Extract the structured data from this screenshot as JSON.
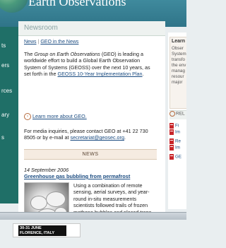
{
  "banner": {
    "title": "Earth Observations"
  },
  "leftnav": {
    "items": [
      "ts",
      "ers",
      "rces",
      "ary",
      "s"
    ]
  },
  "newsroom": {
    "title": "Newsroom",
    "tabs": [
      "News",
      "GEO in the News"
    ],
    "intro": {
      "p1": "The ",
      "em": "Group on Earth Observations",
      "p2": " (GEO) is leading a worldwide effort to build a Global Earth Observation System of Systems (GEOSS) over the next 10 years, as set forth in the ",
      "link": "GEOSS 10-Year Implementation Plan",
      "p3": "."
    },
    "learn_more": "Learn more about GEO.",
    "media": {
      "text": "For media inquiries, please contact GEO at +41 22 730 8505 or by e-mail at ",
      "email": "secretariat@geosec.org",
      "end": "."
    },
    "news_label": "NEWS",
    "article": {
      "date": "14 September 2006",
      "headline": "Greenhouse gas bubbling from permafrost",
      "body": "Using a combination of remote sensing, aerial surveys, and year-round in-situ measurements scientists followed trails of frozen methane bubbles and placed traps"
    }
  },
  "sidebar": {
    "learn_title": "Learn",
    "learn_lines": [
      "Obser",
      "System",
      "transfo",
      "the env",
      "manag",
      "resour",
      "major"
    ],
    "related_label": "REL",
    "pdf_items": [
      "Fi",
      "Im",
      "Re",
      "Im",
      "GE"
    ]
  },
  "thumbnail": {
    "line1": "30-31 JUNE",
    "line2": "FLORENCE, ITALY"
  }
}
